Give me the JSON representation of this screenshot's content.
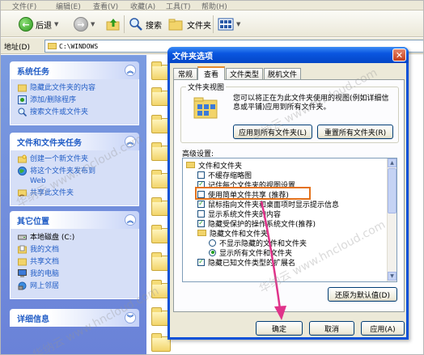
{
  "menubar": {
    "items": [
      "文件(F)",
      "编辑(E)",
      "查看(V)",
      "收藏(A)",
      "工具(T)",
      "帮助(H)"
    ]
  },
  "toolbar": {
    "back_label": "后退",
    "search_label": "搜索",
    "folders_label": "文件夹"
  },
  "address": {
    "label": "地址(D)",
    "value": "C:\\WINDOWS"
  },
  "taskpane": {
    "system_tasks": {
      "title": "系统任务",
      "items": [
        "隐藏此文件夹的内容",
        "添加/删除程序",
        "搜索文件或文件夹"
      ]
    },
    "file_tasks": {
      "title": "文件和文件夹任务",
      "items": [
        "创建一个新文件夹",
        "将这个文件夹发布到\nWeb",
        "共享此文件夹"
      ]
    },
    "other_places": {
      "title": "其它位置",
      "items": [
        "本地磁盘 (C:)",
        "我的文档",
        "共享文档",
        "我的电脑",
        "网上邻居"
      ]
    },
    "details": {
      "title": "详细信息"
    }
  },
  "dialog": {
    "title": "文件夹选项",
    "tabs": [
      "常规",
      "查看",
      "文件类型",
      "脱机文件"
    ],
    "active_tab": "查看",
    "folder_views": {
      "label": "文件夹视图",
      "description": "您可以将正在为此文件夹使用的视图(例如详细信息或平铺)应用到所有文件夹。",
      "apply_all_button": "应用到所有文件夹(L)",
      "reset_all_button": "重置所有文件夹(R)"
    },
    "advanced_label": "高级设置:",
    "advanced_items": [
      {
        "kind": "folder",
        "label": "文件和文件夹"
      },
      {
        "kind": "checkbox",
        "checked": false,
        "label": "不缓存缩略图"
      },
      {
        "kind": "checkbox",
        "checked": true,
        "label": "记住每个文件夹的视图设置"
      },
      {
        "kind": "checkbox",
        "checked": false,
        "label": "使用简单文件共享 (推荐)"
      },
      {
        "kind": "checkbox",
        "checked": true,
        "label": "鼠标指向文件夹和桌面项时显示提示信息"
      },
      {
        "kind": "checkbox",
        "checked": false,
        "label": "显示系统文件夹的内容"
      },
      {
        "kind": "checkbox",
        "checked": true,
        "label": "隐藏受保护的操作系统文件(推荐)"
      },
      {
        "kind": "folder",
        "label": "隐藏文件和文件夹"
      },
      {
        "kind": "radio",
        "checked": false,
        "label": "不显示隐藏的文件和文件夹"
      },
      {
        "kind": "radio",
        "checked": true,
        "label": "显示所有文件和文件夹"
      },
      {
        "kind": "checkbox",
        "checked": true,
        "label": "隐藏已知文件类型的扩展名"
      }
    ],
    "restore_defaults_button": "还原为默认值(D)",
    "ok_button": "确定",
    "cancel_button": "取消",
    "apply_button": "应用(A)"
  },
  "watermark_text": "华纳云 www.hncloud.com",
  "colors": {
    "titlebar": "#0a56e0",
    "taskpane": "#7a9be0",
    "highlight_box": "#e4711a",
    "arrow": "#e0338a"
  }
}
